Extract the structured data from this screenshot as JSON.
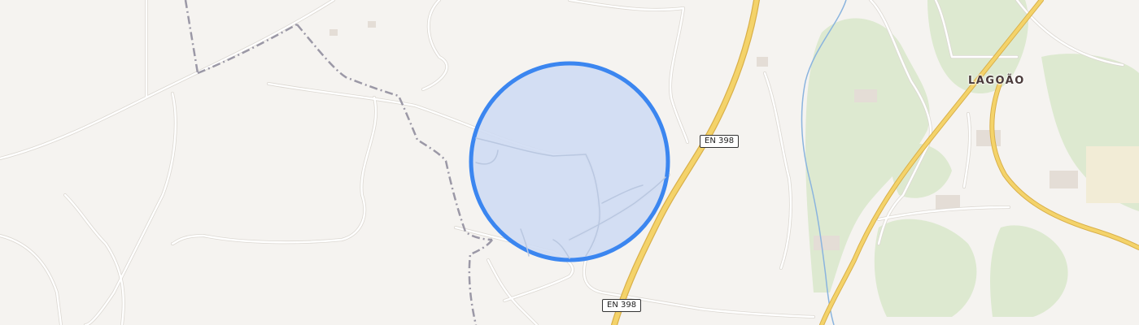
{
  "map": {
    "colors": {
      "land": "#f5f3f0",
      "road": "#ffffff",
      "road_casing": "#dcd8d2",
      "highway": "#f4d36a",
      "highway_casing": "#d9b04a",
      "boundary": "#9b98a6",
      "forest": "#dde9d0",
      "river": "#8ab4de",
      "radius_fill": "#cfdcf3",
      "radius_stroke": "#3b86f0"
    },
    "road_labels": [
      {
        "id": "en398-upper",
        "text": "EN 398"
      },
      {
        "id": "en398-lower",
        "text": "EN 398"
      }
    ],
    "places": [
      {
        "id": "lagoao",
        "text": "LAGOÃO"
      }
    ],
    "search_area": {
      "shape": "circle",
      "description": "selected radius"
    }
  }
}
